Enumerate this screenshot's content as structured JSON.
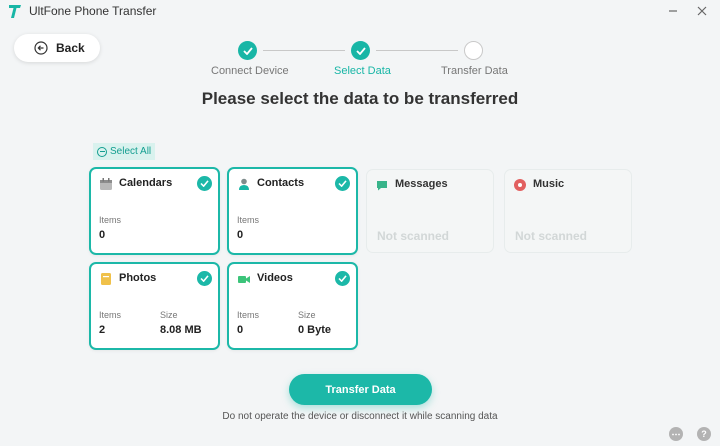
{
  "window": {
    "title": "UltFone Phone Transfer",
    "brand_color": "#18b6a6",
    "controls": [
      "minimize-icon",
      "close-icon"
    ]
  },
  "back_button": {
    "label": "Back",
    "icon": "arrow-left-circle-icon"
  },
  "stepper": {
    "steps": [
      {
        "label": "Connect Device",
        "state": "done"
      },
      {
        "label": "Select Data",
        "state": "current"
      },
      {
        "label": "Transfer Data",
        "state": "pending"
      }
    ]
  },
  "heading": "Please select the data to be transferred",
  "select_all": {
    "label": "Select All"
  },
  "cards": [
    {
      "title": "Calendars",
      "icon": "calendar-icon",
      "selected": true,
      "stats": [
        {
          "label": "Items",
          "value": "0"
        }
      ]
    },
    {
      "title": "Contacts",
      "icon": "contacts-icon",
      "selected": true,
      "stats": [
        {
          "label": "Items",
          "value": "0"
        }
      ]
    },
    {
      "title": "Messages",
      "icon": "messages-icon",
      "selected": false,
      "status": "Not scanned"
    },
    {
      "title": "Music",
      "icon": "music-icon",
      "selected": false,
      "status": "Not scanned"
    },
    {
      "title": "Photos",
      "icon": "photos-icon",
      "selected": true,
      "stats": [
        {
          "label": "Items",
          "value": "2"
        },
        {
          "label": "Size",
          "value": "8.08 MB"
        }
      ]
    },
    {
      "title": "Videos",
      "icon": "videos-icon",
      "selected": true,
      "stats": [
        {
          "label": "Items",
          "value": "0"
        },
        {
          "label": "Size",
          "value": "0 Byte"
        }
      ]
    }
  ],
  "transfer_button": {
    "label": "Transfer Data"
  },
  "hint": "Do not operate the device or disconnect it while scanning data",
  "footer_icons": [
    "chat-icon",
    "help-icon"
  ]
}
